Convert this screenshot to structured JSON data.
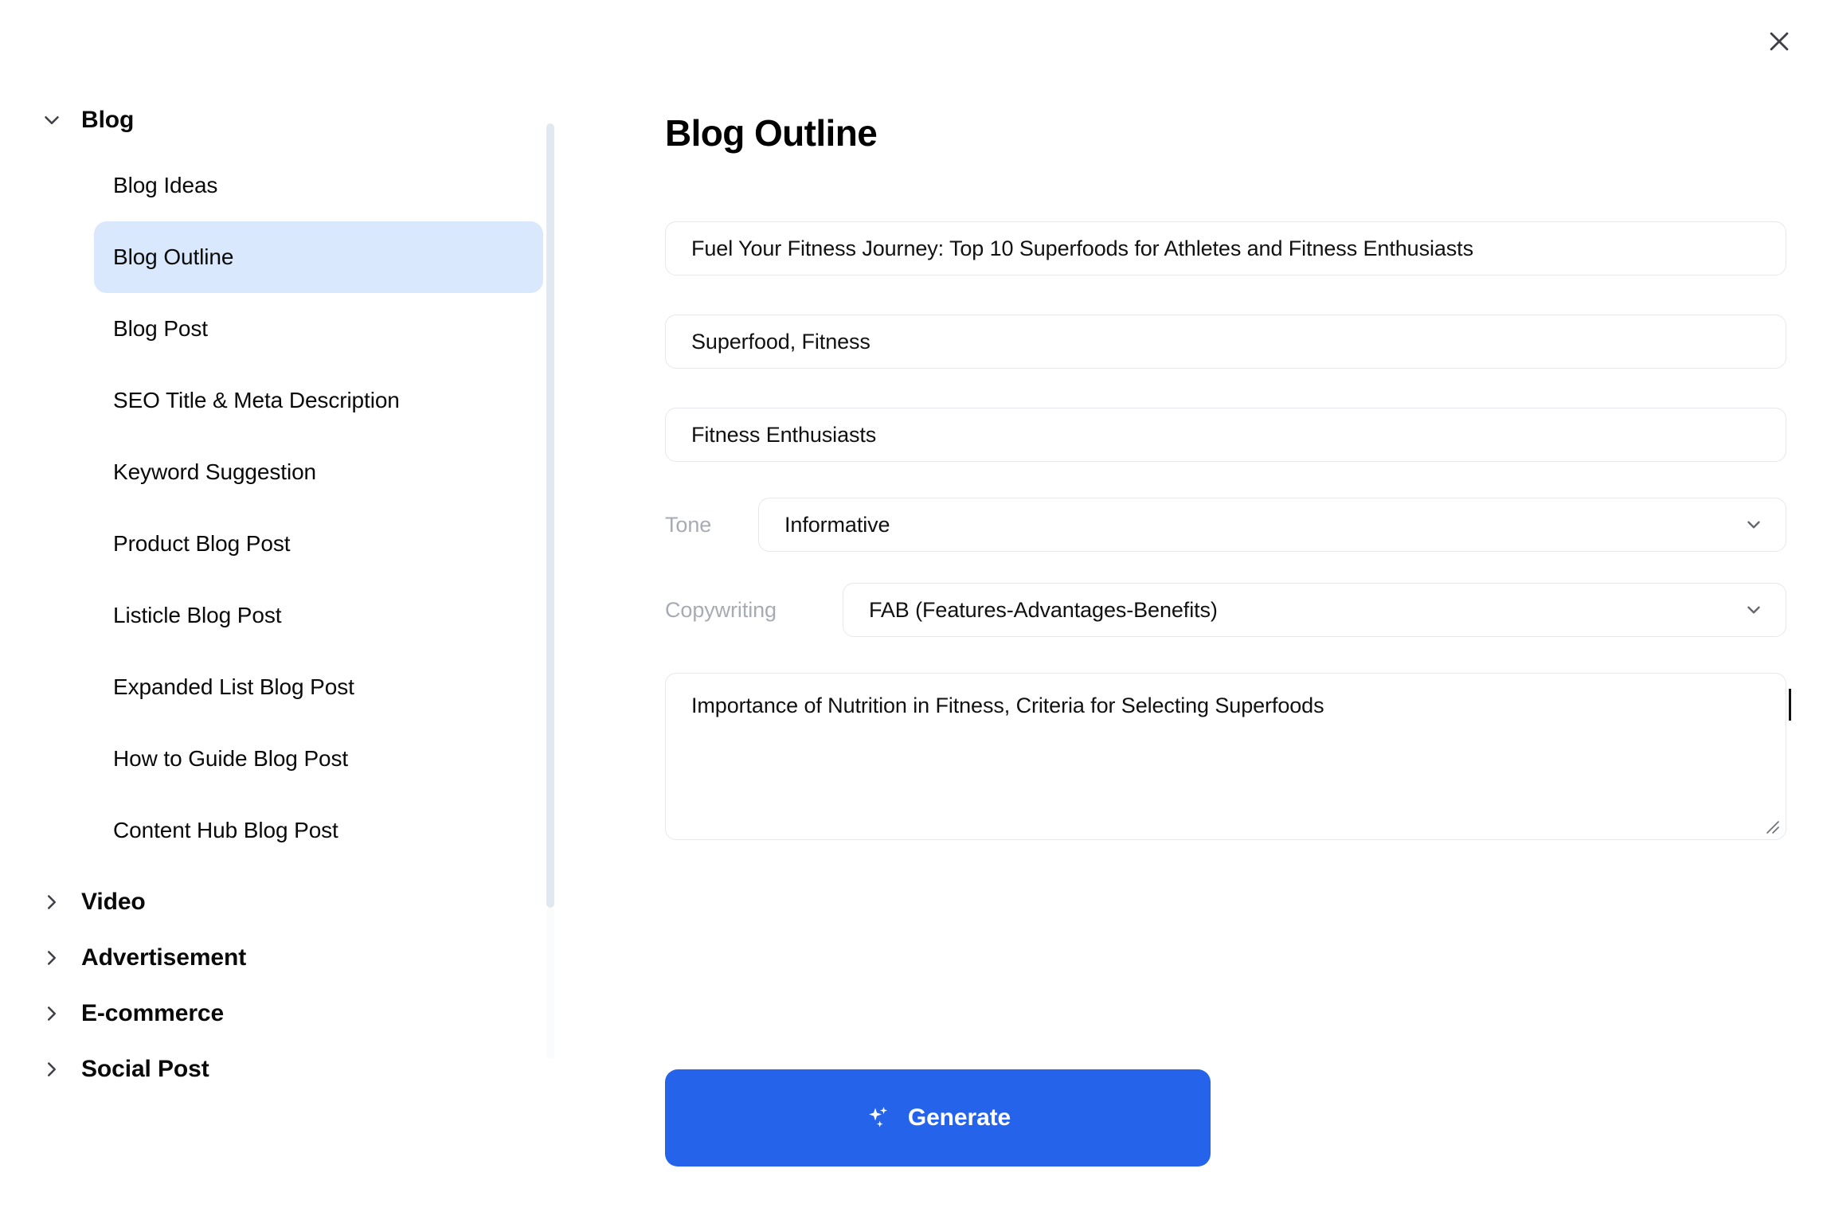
{
  "window": {
    "close_label": "×",
    "close_icon": "close-icon"
  },
  "sidebar": {
    "groups": [
      {
        "label": "Blog",
        "expanded": true,
        "chevron_icon": "chevron-down-icon",
        "items": [
          {
            "label": "Blog Ideas",
            "active": false
          },
          {
            "label": "Blog Outline",
            "active": true
          },
          {
            "label": "Blog Post",
            "active": false
          },
          {
            "label": "SEO Title & Meta Description",
            "active": false
          },
          {
            "label": "Keyword Suggestion",
            "active": false
          },
          {
            "label": "Product Blog Post",
            "active": false
          },
          {
            "label": "Listicle Blog Post",
            "active": false
          },
          {
            "label": "Expanded List Blog Post",
            "active": false
          },
          {
            "label": "How to Guide Blog Post",
            "active": false
          },
          {
            "label": "Content Hub Blog Post",
            "active": false
          }
        ]
      },
      {
        "label": "Video",
        "expanded": false,
        "chevron_icon": "chevron-right-icon",
        "items": []
      },
      {
        "label": "Advertisement",
        "expanded": false,
        "chevron_icon": "chevron-right-icon",
        "items": []
      },
      {
        "label": "E-commerce",
        "expanded": false,
        "chevron_icon": "chevron-right-icon",
        "items": []
      },
      {
        "label": "Social Post",
        "expanded": false,
        "chevron_icon": "chevron-right-icon",
        "items": []
      }
    ],
    "scrollbar": {
      "name": "sidebar-scrollbar"
    }
  },
  "main": {
    "title": "Blog Outline",
    "fields": {
      "topic": {
        "value": "Fuel Your Fitness Journey: Top 10 Superfoods for Athletes and Fitness Enthusiasts",
        "placeholder": ""
      },
      "keywords": {
        "value": "Superfood, Fitness",
        "placeholder": ""
      },
      "audience": {
        "value": "Fitness Enthusiasts",
        "placeholder": ""
      },
      "outline": {
        "value": "Importance of Nutrition in Fitness, Criteria for Selecting Superfoods",
        "placeholder": ""
      }
    },
    "selects": {
      "tone": {
        "label": "Tone",
        "value": "Informative",
        "caret_icon": "chevron-down-icon"
      },
      "copywriting": {
        "label": "Copywriting",
        "value": "FAB (Features-Advantages-Benefits)",
        "caret_icon": "chevron-down-icon"
      }
    },
    "generate": {
      "label": "Generate",
      "icon": "sparkle-icon"
    }
  },
  "colors": {
    "accent": "#2563eb",
    "active_item_bg": "#d9e8fd",
    "border": "#e6e8ec",
    "muted_text": "#a7abb3",
    "scrollbar": "#e2e8f0"
  }
}
